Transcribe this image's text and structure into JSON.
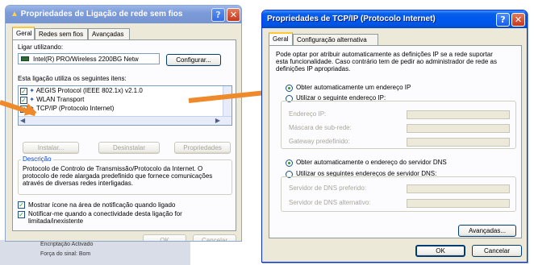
{
  "left_dialog": {
    "title": "Propriedades de Ligação de rede sem fios",
    "tabs": [
      "Geral",
      "Redes sem fios",
      "Avançadas"
    ],
    "connect_using_label": "Ligar utilizando:",
    "adapter_name": "Intel(R) PRO/Wireless 2200BG Netw",
    "configure_button": "Configurar...",
    "items_label": "Esta ligação utiliza os seguintes itens:",
    "items": [
      "AEGIS Protocol (IEEE 802.1x) v2.1.0",
      "WLAN Transport",
      "TCP/IP (Protocolo Internet)"
    ],
    "install_button": "Instalar...",
    "uninstall_button": "Desinstalar",
    "properties_button": "Propriedades",
    "description_label": "Descrição",
    "description_text": "Protocolo de Controlo de Transmissão/Protocolo da Internet. O protocolo de rede alargada predefinido que fornece comunicações através de diversas redes interligadas.",
    "show_icon_label": "Mostrar ícone na área de notificação quando ligado",
    "notify_label": "Notificar-me quando a conectividade desta ligação for limitada/inexistente",
    "ok_button": "OK",
    "cancel_button": "Cancelar"
  },
  "right_dialog": {
    "title": "Propriedades de TCP/IP (Protocolo Internet)",
    "tabs": [
      "Geral",
      "Configuração alternativa"
    ],
    "intro_text": "Pode optar por atribuir automaticamente as definições IP se a rede suportar esta funcionalidade. Caso contrário tem de pedir ao administrador de rede as definições IP apropriadas.",
    "auto_ip_label": "Obter automaticamente um endereço IP",
    "manual_ip_label": "Utilizar o seguinte endereço IP:",
    "ip_address_label": "Endereço IP:",
    "subnet_label": "Máscara de sub-rede:",
    "gateway_label": "Gateway predefinido:",
    "auto_dns_label": "Obter automaticamente o endereço do servidor DNS",
    "manual_dns_label": "Utilizar os seguintes endereços de servidor DNS:",
    "preferred_dns_label": "Servidor de DNS preferido:",
    "alternate_dns_label": "Servidor de DNS alternativo:",
    "advanced_button": "Avançadas...",
    "ok_button": "OK",
    "cancel_button": "Cancelar",
    "auto_ip_selected": true,
    "auto_dns_selected": true
  },
  "background_status": {
    "line1": "Encriptação Activado",
    "line2": "Força do sinal: Bom"
  },
  "colors": {
    "titlebar": "#0055e5",
    "window_bg": "#ece9d8",
    "arrow": "#ee8a2a",
    "selection": "#316ac5"
  }
}
